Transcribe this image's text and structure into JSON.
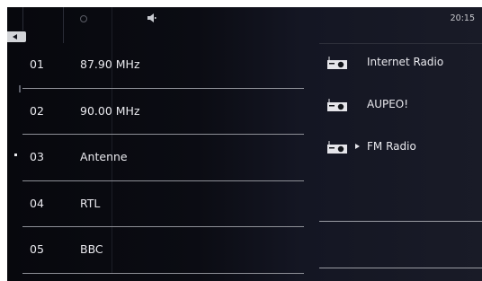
{
  "status_bar": {
    "clock": "20:15",
    "icons": [
      "circle-indicator-icon",
      "speaker-icon"
    ]
  },
  "station_list": {
    "items": [
      {
        "number": "01",
        "name": "87.90 MHz"
      },
      {
        "number": "02",
        "name": "90.00 MHz"
      },
      {
        "number": "03",
        "name": "Antenne"
      },
      {
        "number": "04",
        "name": "RTL"
      },
      {
        "number": "05",
        "name": "BBC"
      }
    ],
    "selected_index": 2
  },
  "source_menu": {
    "items": [
      {
        "label": "Internet Radio",
        "icon": "radio-icon",
        "active": false
      },
      {
        "label": "AUPEO!",
        "icon": "radio-icon",
        "active": false
      },
      {
        "label": "FM Radio",
        "icon": "radio-icon",
        "active": true
      }
    ]
  },
  "colors": {
    "background": "#0b0c13",
    "text": "#e9e9ee",
    "separator": "#8e9097",
    "back_tab": "#d2d4d8"
  }
}
